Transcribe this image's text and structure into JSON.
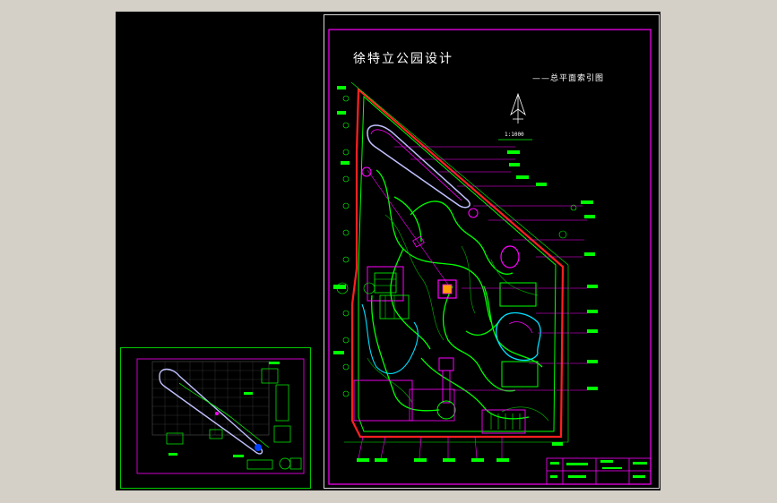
{
  "drawing": {
    "title": "徐特立公园设计",
    "subtitle": "——总平面索引图",
    "scale": "1:1000"
  },
  "colors": {
    "viewport_bg": "#000000",
    "window_bg": "#d4d0c8",
    "boundary": "#ff2020",
    "frame": "#ff00ff",
    "path": "#00ff00",
    "water": "#00c0ff",
    "structure": "#ff00ff",
    "label": "#ffffff",
    "leader": "#ff00ff"
  }
}
